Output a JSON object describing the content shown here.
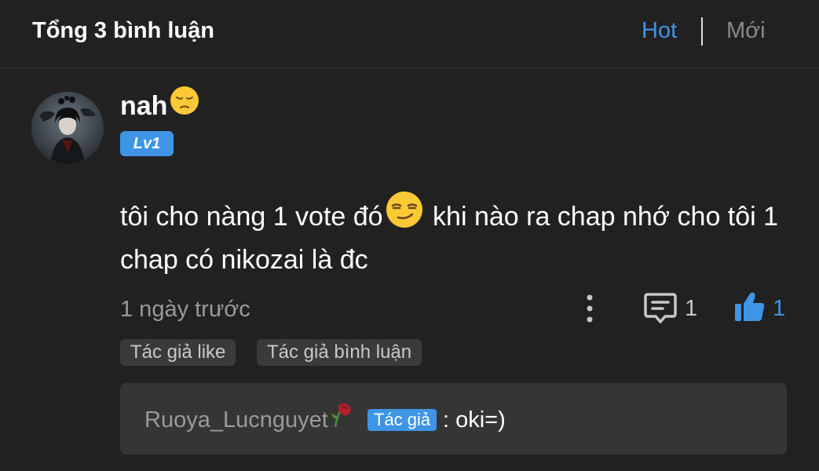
{
  "header": {
    "title": "Tổng 3 bình luận",
    "sort_hot": "Hot",
    "sort_new": "Mới"
  },
  "comment": {
    "username": "nah",
    "username_emoji": "pensive-face",
    "level": "Lv1",
    "text_part1": "tôi cho nàng 1 vote đó",
    "text_emoji": "smirking-face",
    "text_part2": " khi nào ra chap nhớ cho tôi 1 chap có nikozai là đc",
    "time": "1 ngày trước",
    "reply_count": "1",
    "like_count": "1",
    "tags": [
      "Tác giả like",
      "Tác giả bình luận"
    ],
    "reply": {
      "author": "Ruoya_Lucnguyet",
      "author_emoji": "wilted-rose",
      "author_badge": "Tác giả",
      "text": ": oki=)"
    }
  },
  "colors": {
    "background": "#212121",
    "accent": "#3e95e6",
    "muted_text": "#9a9a9a",
    "reply_box": "#353535"
  }
}
